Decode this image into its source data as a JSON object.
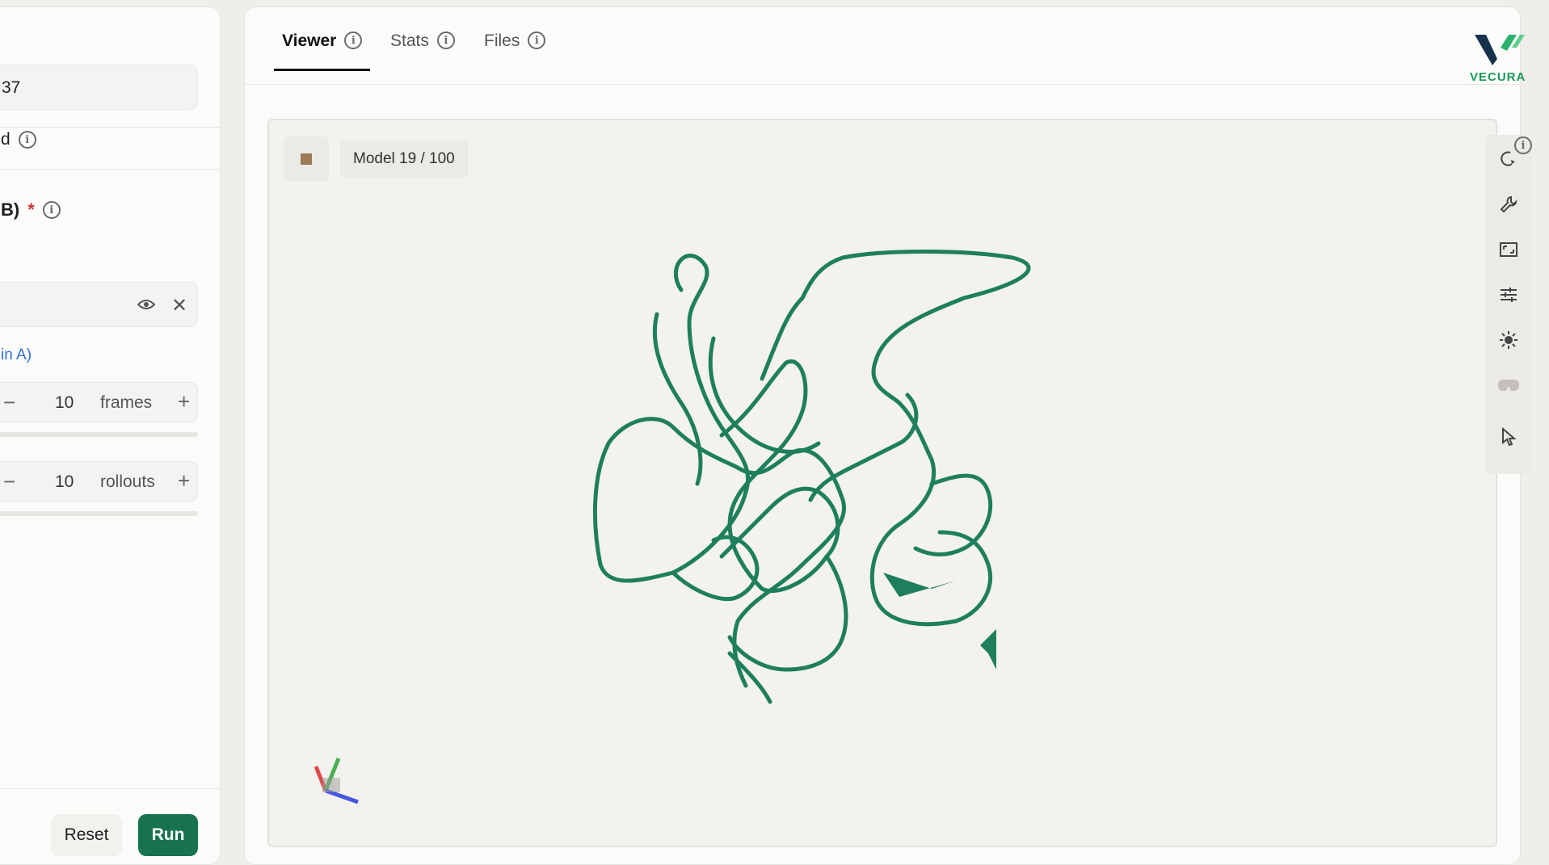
{
  "left_panel": {
    "seed_value": "37",
    "option_label": "d",
    "pdb_label": "B)",
    "required_mark": "*",
    "chain_link": "in A)",
    "frames": {
      "minus": "−",
      "value": "10",
      "unit": "frames",
      "plus": "+"
    },
    "rollouts": {
      "minus": "−",
      "value": "10",
      "unit": "rollouts",
      "plus": "+"
    },
    "reset_label": "Reset",
    "run_label": "Run"
  },
  "tabs": [
    {
      "label": "Viewer",
      "active": true
    },
    {
      "label": "Stats",
      "active": false
    },
    {
      "label": "Files",
      "active": false
    }
  ],
  "logo": {
    "text": "VECURA",
    "color": "#1c9a5a"
  },
  "viewer": {
    "model_label": "Model 19 / 100",
    "structure_color": "#1e7f5c",
    "toolbar_icons": [
      "rotate-icon",
      "wrench-icon",
      "fullscreen-icon",
      "sliders-icon",
      "sun-icon",
      "vr-headset-icon",
      "pointer-icon"
    ]
  },
  "info_glyph": "i",
  "close_glyph": "✕",
  "colors": {
    "accent": "#17734f",
    "required": "#d23a3a",
    "link": "#2f6fd6"
  }
}
